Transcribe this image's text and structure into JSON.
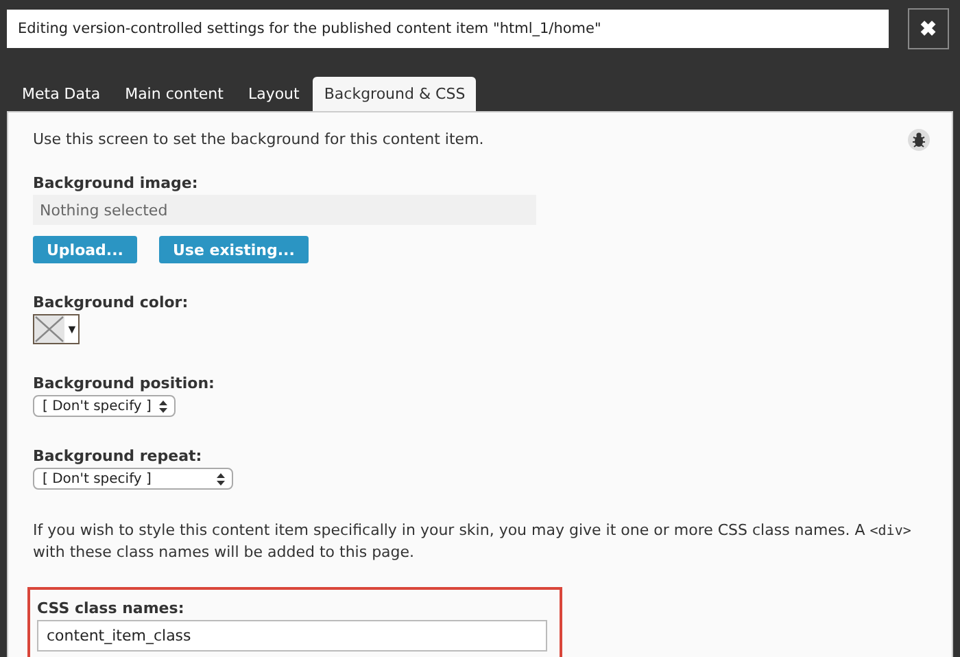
{
  "dialog": {
    "title": "Editing version-controlled settings for the published content item \"html_1/home\"",
    "close": "✖"
  },
  "tabs": [
    {
      "label": "Meta Data",
      "selected": false
    },
    {
      "label": "Main content",
      "selected": false
    },
    {
      "label": "Layout",
      "selected": false
    },
    {
      "label": "Background & CSS",
      "selected": true
    }
  ],
  "intro": "Use this screen to set the background for this content item.",
  "background_image": {
    "label": "Background image:",
    "value": "Nothing selected",
    "buttons": [
      "Upload...",
      "Use existing..."
    ]
  },
  "background_color": {
    "label": "Background color:",
    "caret": "▼"
  },
  "selects": [
    {
      "label": "Background position:",
      "value": "[ Don't specify ]"
    },
    {
      "label": "Background repeat:",
      "value": "[ Don't specify ]"
    }
  ],
  "css_help": {
    "before": "If you wish to style this content item specifically in your skin, you may give it one or more CSS class names. A ",
    "code": "<div>",
    "after": " with these class names will be added to this page."
  },
  "css_class": {
    "label": "CSS class names:",
    "value": "content_item_class",
    "highlighted": true
  }
}
